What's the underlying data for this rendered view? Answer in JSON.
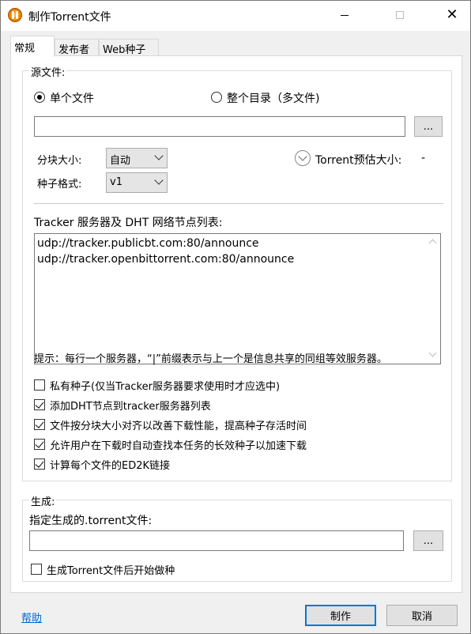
{
  "window": {
    "title": "制作Torrent文件",
    "minimize": "—",
    "maximize": "□",
    "close": "✕"
  },
  "tabs": [
    {
      "label": "常规",
      "active": true
    },
    {
      "label": "发布者",
      "active": false
    },
    {
      "label": "Web种子",
      "active": false
    }
  ],
  "source": {
    "group_title": "源文件:",
    "radio_single": "单个文件",
    "radio_dir": "整个目录（多文件)",
    "path_value": "",
    "browse_label": "...",
    "block_size_label": "分块大小:",
    "block_size_value": "自动",
    "torrent_format_label": "种子格式:",
    "torrent_format_value": "v1",
    "estimate_label": "Torrent预估大小:",
    "estimate_value": "-",
    "tracker_label": "Tracker 服务器及 DHT 网络节点列表:",
    "trackers": [
      "udp://tracker.publicbt.com:80/announce",
      "udp://tracker.openbittorrent.com:80/announce"
    ],
    "hint": "提示：每行一个服务器，“|”前缀表示与上一个是信息共享的同组等效服务器。",
    "options": [
      {
        "label": "私有种子(仅当Tracker服务器要求使用时才应选中)",
        "checked": false
      },
      {
        "label": "添加DHT节点到tracker服务器列表",
        "checked": true
      },
      {
        "label": "文件按分块大小对齐以改善下载性能，提高种子存活时间",
        "checked": true
      },
      {
        "label": "允许用户在下载时自动查找本任务的长效种子以加速下载",
        "checked": true
      },
      {
        "label": "计算每个文件的ED2K链接",
        "checked": true
      }
    ]
  },
  "generate": {
    "group_title": "生成:",
    "target_label": "指定生成的.torrent文件:",
    "target_value": "",
    "browse_label": "...",
    "seed_after_label": "生成Torrent文件后开始做种",
    "seed_after_checked": false
  },
  "footer": {
    "help_label": "帮助",
    "create_label": "制作",
    "cancel_label": "取消"
  }
}
